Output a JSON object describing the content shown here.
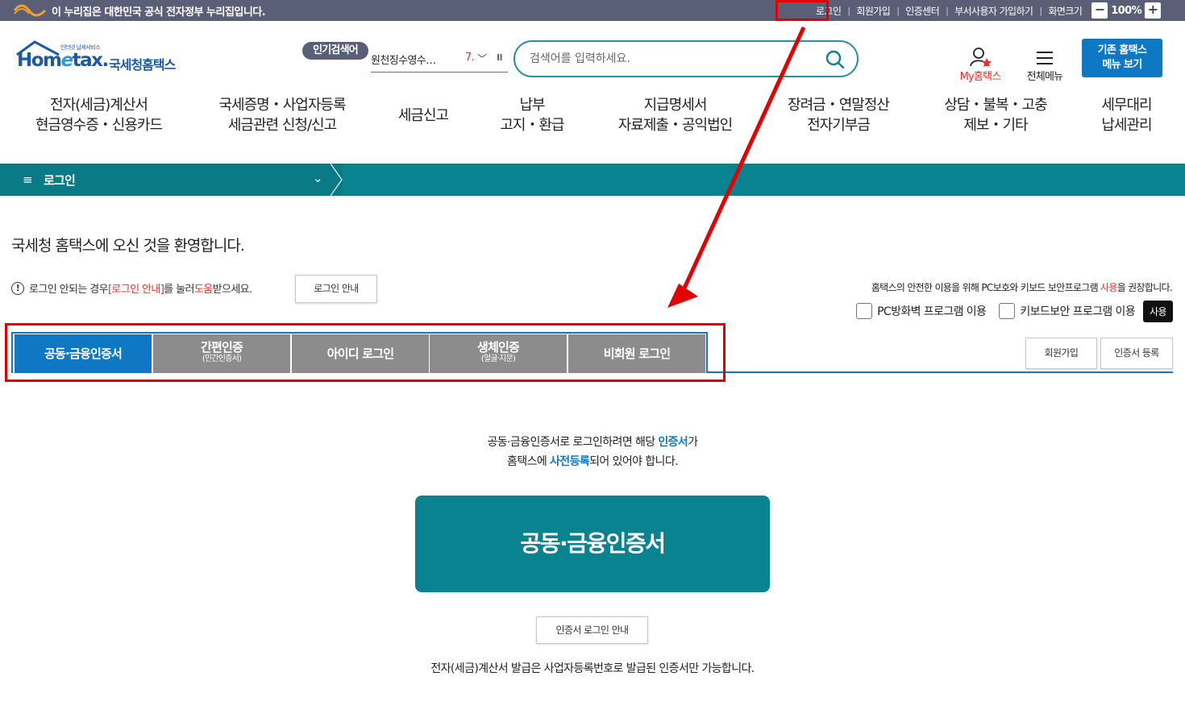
{
  "topbar": {
    "gov_notice": "이 누리집은 대한민국 공식 전자정부 누리집입니다.",
    "links": [
      "로그인",
      "회원가입",
      "인증센터",
      "부서사용자 가입하기",
      "화면크기"
    ],
    "zoom_minus": "−",
    "zoom_value": "100%",
    "zoom_plus": "+"
  },
  "header": {
    "logo_small": "인터넷 납세서비스",
    "logo_word_a": "Hom",
    "logo_word_e": "e",
    "logo_word_b": "tax.",
    "logo_korean": "국세청홈택스",
    "popular_badge": "인기검색어",
    "popular_keyword": "원천징수영수…",
    "popular_rank": "7.",
    "search_placeholder": "검색어를 입력하세요.",
    "my_hometax": "My홈택스",
    "all_menu": "전체메뉴",
    "legacy_line1": "기존 홈택스",
    "legacy_line2": "메뉴 보기"
  },
  "gnb": [
    {
      "l1": "전자(세금)계산서",
      "l2": "현금영수증・신용카드"
    },
    {
      "l1": "국세증명・사업자등록",
      "l2": "세금관련 신청/신고"
    },
    {
      "l1": "세금신고",
      "l2": ""
    },
    {
      "l1": "납부",
      "l2": "고지・환급"
    },
    {
      "l1": "지급명세서",
      "l2": "자료제출・공익법인"
    },
    {
      "l1": "장려금・연말정산",
      "l2": "전자기부금"
    },
    {
      "l1": "상담・불복・고충",
      "l2": "제보・기타"
    },
    {
      "l1": "세무대리",
      "l2": "납세관리"
    }
  ],
  "location": {
    "current": "로그인"
  },
  "login": {
    "welcome": "국세청 홈택스에 오신 것을 환영합니다.",
    "notice_a": "로그인 안되는 경우 ",
    "notice_b": "[로그인 안내]",
    "notice_c": "를 눌러 ",
    "notice_d": "도움",
    "notice_e": "받으세요.",
    "guide_button": "로그인 안내",
    "security_a": "홈택스의 안전한 이용을 위해 PC보호와 키보드 보안프로그램 ",
    "security_b": "사용",
    "security_c": "을 권장합니다.",
    "opt_pc": "PC방화벽 프로그램 이용",
    "opt_kb": "키보드보안 프로그램 이용",
    "use_button": "사용",
    "signup_button": "회원가입",
    "cert_register_button": "인증서 등록"
  },
  "tabs": [
    {
      "label": "공동·금융인증서",
      "sub": ""
    },
    {
      "label": "간편인증",
      "sub": "(민간인증서)"
    },
    {
      "label": "아이디 로그인",
      "sub": ""
    },
    {
      "label": "생체인증",
      "sub": "(얼굴·지문)"
    },
    {
      "label": "비회원 로그인",
      "sub": ""
    }
  ],
  "cert": {
    "desc1_a": "공동·금융인증서로 로그인하려면 해당 ",
    "desc1_b": "인증서",
    "desc1_c": "가",
    "desc2_a": "홈택스에 ",
    "desc2_b": "사전등록",
    "desc2_c": "되어 있어야 합니다.",
    "button": "공동·금융인증서",
    "guide_button": "인증서 로그인 안내",
    "bottom_note": "전자(세금)계산서 발급은 사업자등록번호로 발급된 인증서만 가능합니다."
  },
  "colors": {
    "topbar": "#5a5f77",
    "teal": "#0a8391",
    "blue": "#0e78c4",
    "annotation_red": "#e30000"
  }
}
